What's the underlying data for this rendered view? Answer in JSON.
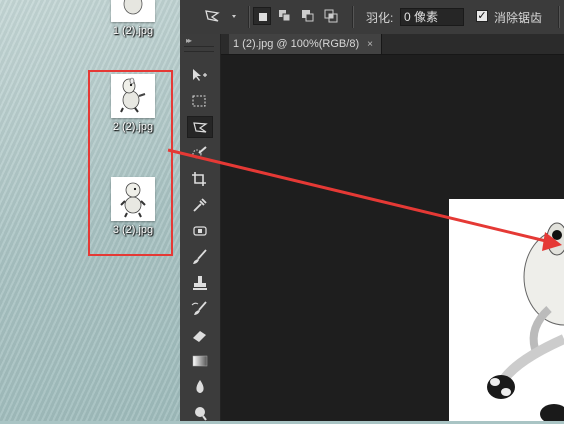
{
  "desktop": {
    "files": [
      {
        "name": "1 (2).jpg"
      },
      {
        "name": "2 (2).jpg"
      },
      {
        "name": "3 (2).jpg"
      }
    ]
  },
  "photoshop": {
    "options_bar": {
      "feather_label": "羽化:",
      "feather_value": "0 像素",
      "antialias_label": "消除锯齿",
      "antialias_checked": true
    },
    "toolbar": {
      "collapse_glyph": "▸▸",
      "tools": [
        "move",
        "rect-marquee",
        "polygonal-lasso",
        "quick-selection",
        "crop",
        "eyedropper",
        "spot-healing",
        "brush",
        "clone-stamp",
        "history-brush",
        "eraser",
        "gradient",
        "blur",
        "dodge"
      ],
      "active_tool": "polygonal-lasso"
    },
    "document_tab": {
      "title": "1 (2).jpg @ 100%(RGB/8)",
      "close": "×"
    }
  },
  "annotation": {
    "color": "#e53935"
  }
}
